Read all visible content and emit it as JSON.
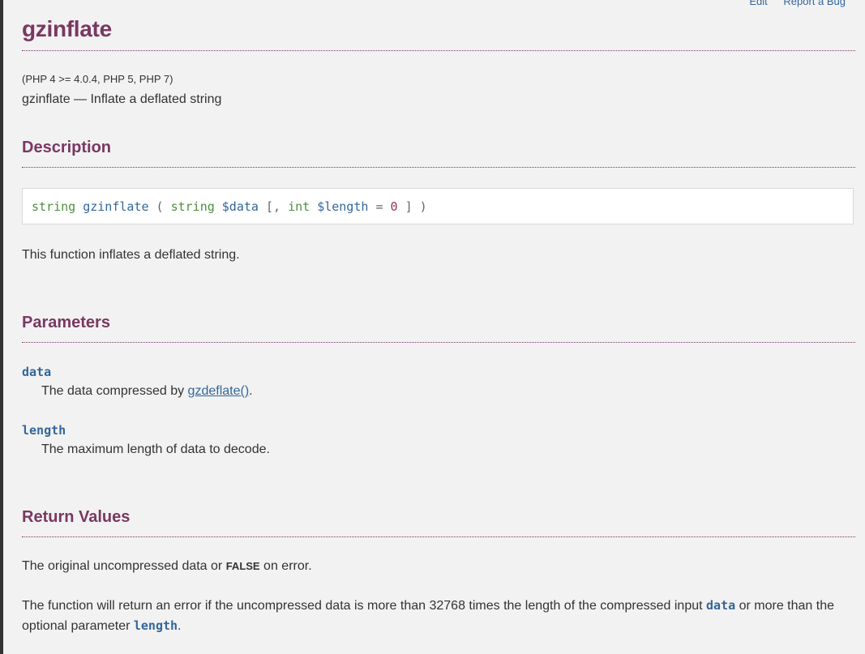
{
  "topnav": {
    "edit": "Edit",
    "report_bug": "Report a Bug"
  },
  "page": {
    "title": "gzinflate",
    "versions": "(PHP 4 >= 4.0.4, PHP 5, PHP 7)",
    "refpurpose": "gzinflate — Inflate a deflated string"
  },
  "description": {
    "heading": "Description",
    "synopsis": {
      "return_type": "string",
      "function_name": "gzinflate",
      "open_paren": "(",
      "param1_type": "string",
      "param1_name": "$data",
      "optional_open": "[,",
      "param2_type": "int",
      "param2_name": "$length",
      "equals": "=",
      "param2_default": "0",
      "optional_close": "]",
      "close_paren": ")"
    },
    "text": "This function inflates a deflated string."
  },
  "parameters": {
    "heading": "Parameters",
    "items": [
      {
        "name": "data",
        "desc_before": "The data compressed by ",
        "link": "gzdeflate()",
        "desc_after": "."
      },
      {
        "name": "length",
        "desc": "The maximum length of data to decode."
      }
    ]
  },
  "return_values": {
    "heading": "Return Values",
    "line1_before": "The original uncompressed data or ",
    "line1_constant": "FALSE",
    "line1_after": " on error.",
    "line2_before": "The function will return an error if the uncompressed data is more than 32768 times the length of the compressed input ",
    "line2_code1": "data",
    "line2_middle": " or more than the optional parameter ",
    "line2_code2": "length",
    "line2_after": "."
  }
}
